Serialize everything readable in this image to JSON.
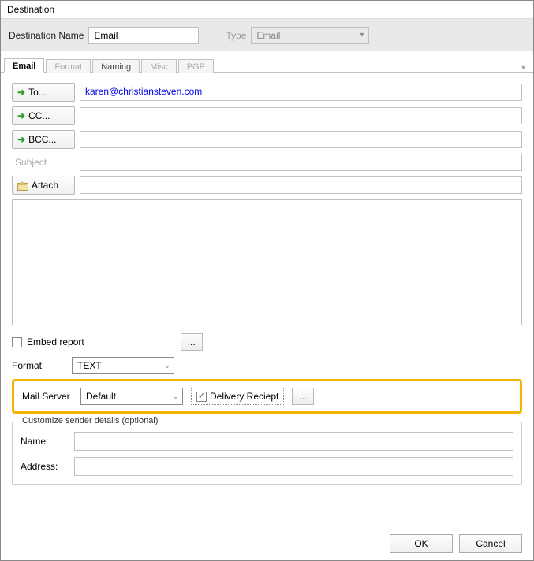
{
  "window": {
    "title": "Destination"
  },
  "header": {
    "dest_name_label": "Destination Name",
    "dest_name_value": "Email",
    "type_label": "Type",
    "type_value": "Email"
  },
  "tabs": {
    "email": "Email",
    "format": "Format",
    "naming": "Naming",
    "misc": "Misc",
    "pgp": "PGP"
  },
  "email": {
    "to_label": "To...",
    "cc_label": "CC...",
    "bcc_label": "BCC...",
    "to_value": "karen@christiansteven.com",
    "cc_value": "",
    "bcc_value": "",
    "subject_label": "Subject",
    "subject_value": "",
    "attach_label": "Attach",
    "attach_value": "",
    "body_value": ""
  },
  "embed": {
    "label": "Embed report",
    "checked": false
  },
  "format": {
    "label": "Format",
    "value": "TEXT"
  },
  "mail_server": {
    "label": "Mail Server",
    "value": "Default",
    "delivery_label": "Delivery Reciept",
    "delivery_checked": true,
    "dots": "..."
  },
  "sender": {
    "legend": "Customize sender details (optional)",
    "name_label": "Name:",
    "name_value": "",
    "address_label": "Address:",
    "address_value": ""
  },
  "footer": {
    "ok": "OK",
    "cancel": "Cancel"
  },
  "misc": {
    "dots": "..."
  }
}
